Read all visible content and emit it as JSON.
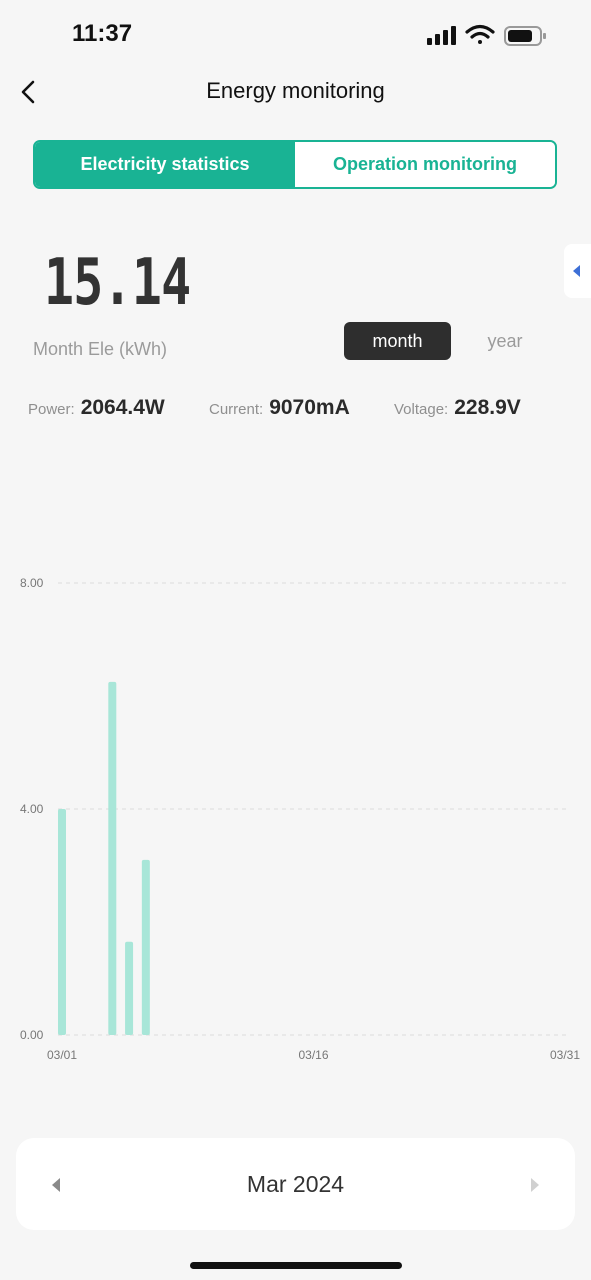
{
  "status_bar": {
    "time": "11:37"
  },
  "header": {
    "title": "Energy monitoring"
  },
  "tabs": [
    {
      "label": "Electricity statistics",
      "active": true
    },
    {
      "label": "Operation monitoring",
      "active": false
    }
  ],
  "summary": {
    "value": "15.14",
    "label": "Month Ele (kWh)"
  },
  "period_toggle": {
    "month": "month",
    "year": "year",
    "selected": "month"
  },
  "metrics": {
    "power": {
      "label": "Power:",
      "value": "2064.4W"
    },
    "current": {
      "label": "Current:",
      "value": "9070mA"
    },
    "voltage": {
      "label": "Voltage:",
      "value": "228.9V"
    }
  },
  "month_selector": {
    "label": "Mar 2024"
  },
  "colors": {
    "accent": "#19b394",
    "bar": "#a8e6d8",
    "toggle_active": "#2e2e2e"
  },
  "chart_data": {
    "type": "bar",
    "ylim": [
      0,
      8
    ],
    "y_ticks": [
      "0.00",
      "4.00",
      "8.00"
    ],
    "x_ticks": [
      "03/01",
      "03/16",
      "03/31"
    ],
    "x_range": [
      1,
      31
    ],
    "x": [
      1,
      4,
      5,
      6
    ],
    "values": [
      4.0,
      6.25,
      1.65,
      3.1
    ],
    "grid": true
  }
}
